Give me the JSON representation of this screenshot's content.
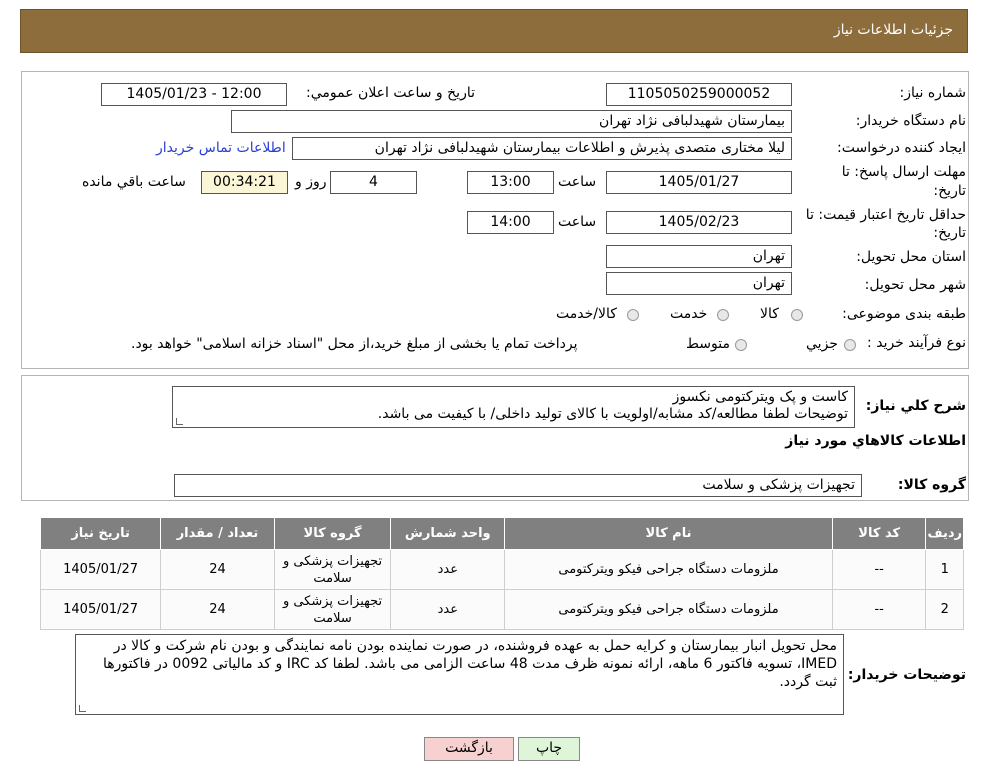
{
  "header": {
    "title": "جزئیات اطلاعات نیاز"
  },
  "form": {
    "need_number_label": "شماره نیاز:",
    "need_number": "1105050259000052",
    "announce_label": "تاریخ و ساعت اعلان عمومي:",
    "announce_value": "1405/01/23 - 12:00",
    "buyer_org_label": "نام دستگاه خريدار:",
    "buyer_org": "بیمارستان شهیدلبافی نژاد تهران",
    "creator_label": "ايجاد كننده درخواست:",
    "creator": "لیلا مختاری متصدی پذیرش و اطلاعات بیمارستان شهیدلبافی نژاد تهران",
    "contact_link": "اطلاعات تماس خريدار",
    "deadline_label_1": "مهلت ارسال پاسخ: تا",
    "deadline_label_2": "تاريخ:",
    "deadline_date": "1405/01/27",
    "time_label": "ساعت",
    "deadline_time": "13:00",
    "days_value": "4",
    "days_label": "روز و",
    "remaining_time": "00:34:21",
    "remaining_label": "ساعت باقي مانده",
    "validity_label_1": "حداقل تاريخ اعتبار قيمت: تا",
    "validity_label_2": "تاريخ:",
    "validity_date": "1405/02/23",
    "validity_time": "14:00",
    "province_label": "استان محل تحويل:",
    "province": "تهران",
    "city_label": "شهر محل تحويل:",
    "city": "تهران",
    "category_label": "طبقه بندی موضوعی:",
    "category_options": [
      "كالا",
      "خدمت",
      "كالا/خدمت"
    ],
    "process_label": "نوع فرآيند خريد :",
    "process_options": [
      "جزيي",
      "متوسط"
    ],
    "process_note": "پرداخت تمام يا بخشی از مبلغ خريد،از محل \"اسناد خزانه اسلامی\" خواهد بود."
  },
  "summary": {
    "label": "شرح كلي نياز:",
    "line1": "کاست و پک ویترکتومی نکسوز",
    "line2": "توضیحات لطفا مطالعه/کد مشابه/اولویت با کالای تولید داخلی/ با کیفیت می باشد.",
    "goods_info_title": "اطلاعات كالاهاي مورد نياز",
    "group_label": "گروه كالا:",
    "group_value": "تجهيزات پزشکی و سلامت"
  },
  "table": {
    "headers": [
      "رديف",
      "كد كالا",
      "نام كالا",
      "واحد شمارش",
      "گروه كالا",
      "تعداد / مقدار",
      "تاريخ نياز"
    ],
    "rows": [
      [
        "1",
        "--",
        "ملزومات دستگاه جراحی فیکو ویترکتومی",
        "عدد",
        "تجهيزات پزشکی و سلامت",
        "24",
        "1405/01/27"
      ],
      [
        "2",
        "--",
        "ملزومات دستگاه جراحی فیکو ویترکتومی",
        "عدد",
        "تجهيزات پزشکی و سلامت",
        "24",
        "1405/01/27"
      ]
    ]
  },
  "buyer_notes": {
    "label": "توضيحات خريدار:",
    "text": "محل تحویل انبار بیمارستان و کرایه حمل به عهده فروشنده، در صورت نماینده بودن نامه نمایندگی و بودن نام شرکت و کالا در IMED، تسویه فاکتور 6 ماهه، ارائه نمونه ظرف مدت 48 ساعت الزامی می باشد. لطفا کد IRC و کد مالیاتی 0092 در فاکتورها ثبت گردد."
  },
  "buttons": {
    "print": "چاپ",
    "back": "بازگشت"
  },
  "colors": {
    "header_bg": "#8d6d3b",
    "table_header_bg": "#808080",
    "back_button_bg": "#f7d0d0",
    "print_button_bg": "#dff5d8",
    "link": "#2a3fd1"
  }
}
